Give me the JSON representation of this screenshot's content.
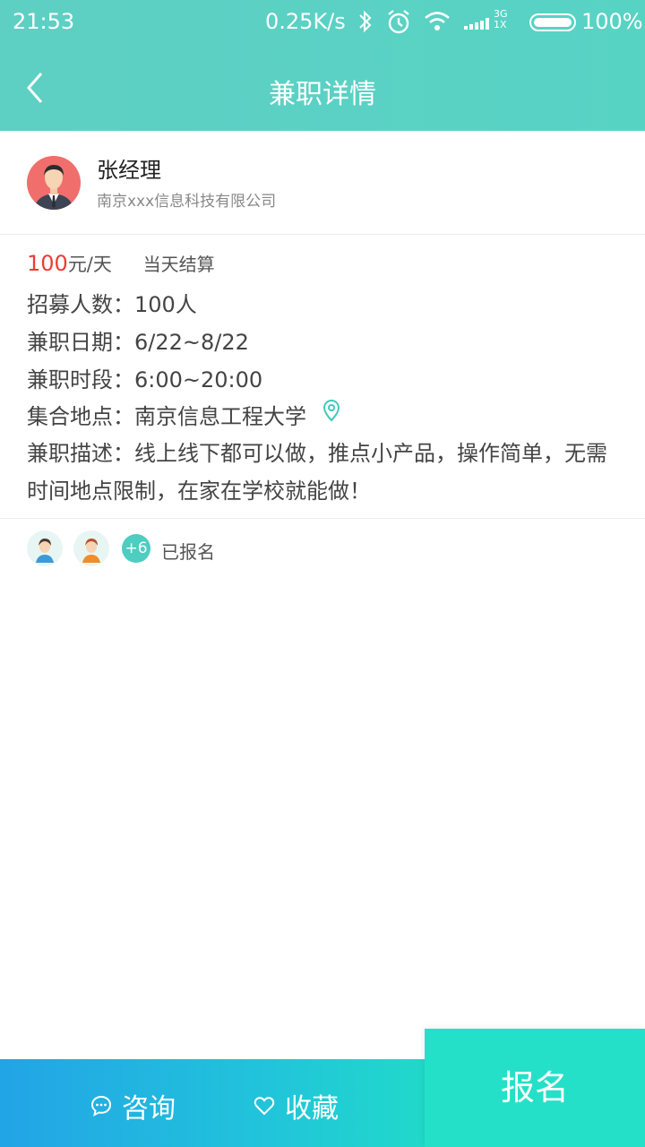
{
  "status_bar": {
    "time": "21:53",
    "speed": "0.25K/s",
    "network_top": "3G",
    "network_bottom": "1X",
    "battery": "100%"
  },
  "nav": {
    "title": "兼职详情"
  },
  "profile": {
    "name": "张经理",
    "company": "南京xxx信息科技有限公司"
  },
  "job": {
    "salary_value": "100",
    "salary_unit": "元/天",
    "settlement": "当天结算",
    "recruit": "招募人数：100人",
    "date": "兼职日期：6/22~8/22",
    "time": "兼职时段：6:00~20:00",
    "location": "集合地点：南京信息工程大学",
    "description": "兼职描述：线上线下都可以做，推点小产品，操作简单，无需时间地点限制，在家在学校就能做！"
  },
  "signup": {
    "extra_count": "+6",
    "label": "已报名"
  },
  "bottom": {
    "consult": "咨询",
    "collect": "收藏",
    "apply": "报名"
  },
  "colors": {
    "header": "#57d3c4",
    "accent": "#25e0c8",
    "price": "#ee3b33"
  }
}
